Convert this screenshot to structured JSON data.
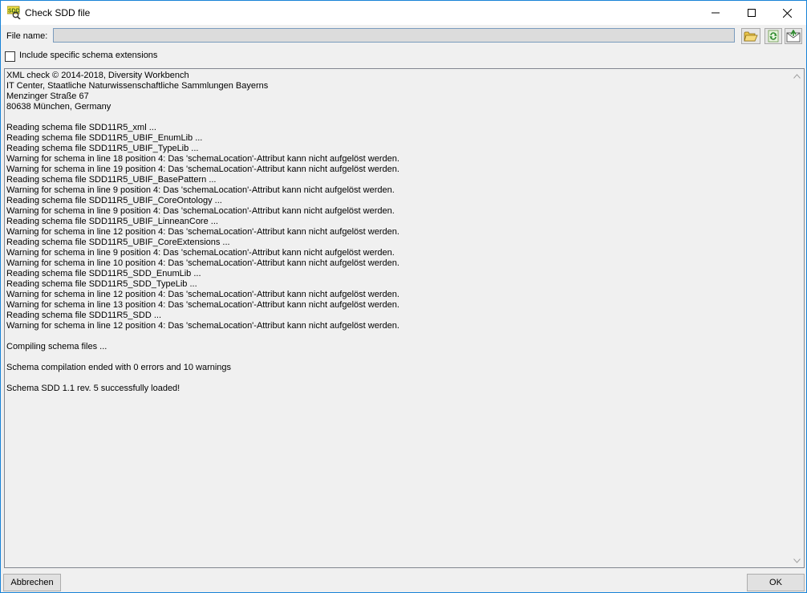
{
  "window": {
    "title": "Check SDD file",
    "icon": "sdd-app-icon"
  },
  "file": {
    "label": "File name:",
    "value": ""
  },
  "options": {
    "include_extensions_label": "Include specific schema extensions",
    "include_extensions_checked": false
  },
  "output": {
    "text": "XML check © 2014-2018, Diversity Workbench\nIT Center, Staatliche Naturwissenschaftliche Sammlungen Bayerns\nMenzinger Straße 67\n80638 München, Germany\n\nReading schema file SDD11R5_xml ...\nReading schema file SDD11R5_UBIF_EnumLib ...\nReading schema file SDD11R5_UBIF_TypeLib ...\nWarning for schema in line 18 position 4: Das 'schemaLocation'-Attribut kann nicht aufgelöst werden.\nWarning for schema in line 19 position 4: Das 'schemaLocation'-Attribut kann nicht aufgelöst werden.\nReading schema file SDD11R5_UBIF_BasePattern ...\nWarning for schema in line 9 position 4: Das 'schemaLocation'-Attribut kann nicht aufgelöst werden.\nReading schema file SDD11R5_UBIF_CoreOntology ...\nWarning for schema in line 9 position 4: Das 'schemaLocation'-Attribut kann nicht aufgelöst werden.\nReading schema file SDD11R5_UBIF_LinneanCore ...\nWarning for schema in line 12 position 4: Das 'schemaLocation'-Attribut kann nicht aufgelöst werden.\nReading schema file SDD11R5_UBIF_CoreExtensions ...\nWarning for schema in line 9 position 4: Das 'schemaLocation'-Attribut kann nicht aufgelöst werden.\nWarning for schema in line 10 position 4: Das 'schemaLocation'-Attribut kann nicht aufgelöst werden.\nReading schema file SDD11R5_SDD_EnumLib ...\nReading schema file SDD11R5_SDD_TypeLib ...\nWarning for schema in line 12 position 4: Das 'schemaLocation'-Attribut kann nicht aufgelöst werden.\nWarning for schema in line 13 position 4: Das 'schemaLocation'-Attribut kann nicht aufgelöst werden.\nReading schema file SDD11R5_SDD ...\nWarning for schema in line 12 position 4: Das 'schemaLocation'-Attribut kann nicht aufgelöst werden.\n\nCompiling schema files ...\n\nSchema compilation ended with 0 errors and 10 warnings\n\nSchema SDD 1.1 rev. 5 successfully loaded!"
  },
  "buttons": {
    "cancel": "Abbrechen",
    "ok": "OK"
  },
  "icons": {
    "open": "folder-open-icon",
    "reload": "reload-icon",
    "check": "check-mail-icon"
  }
}
